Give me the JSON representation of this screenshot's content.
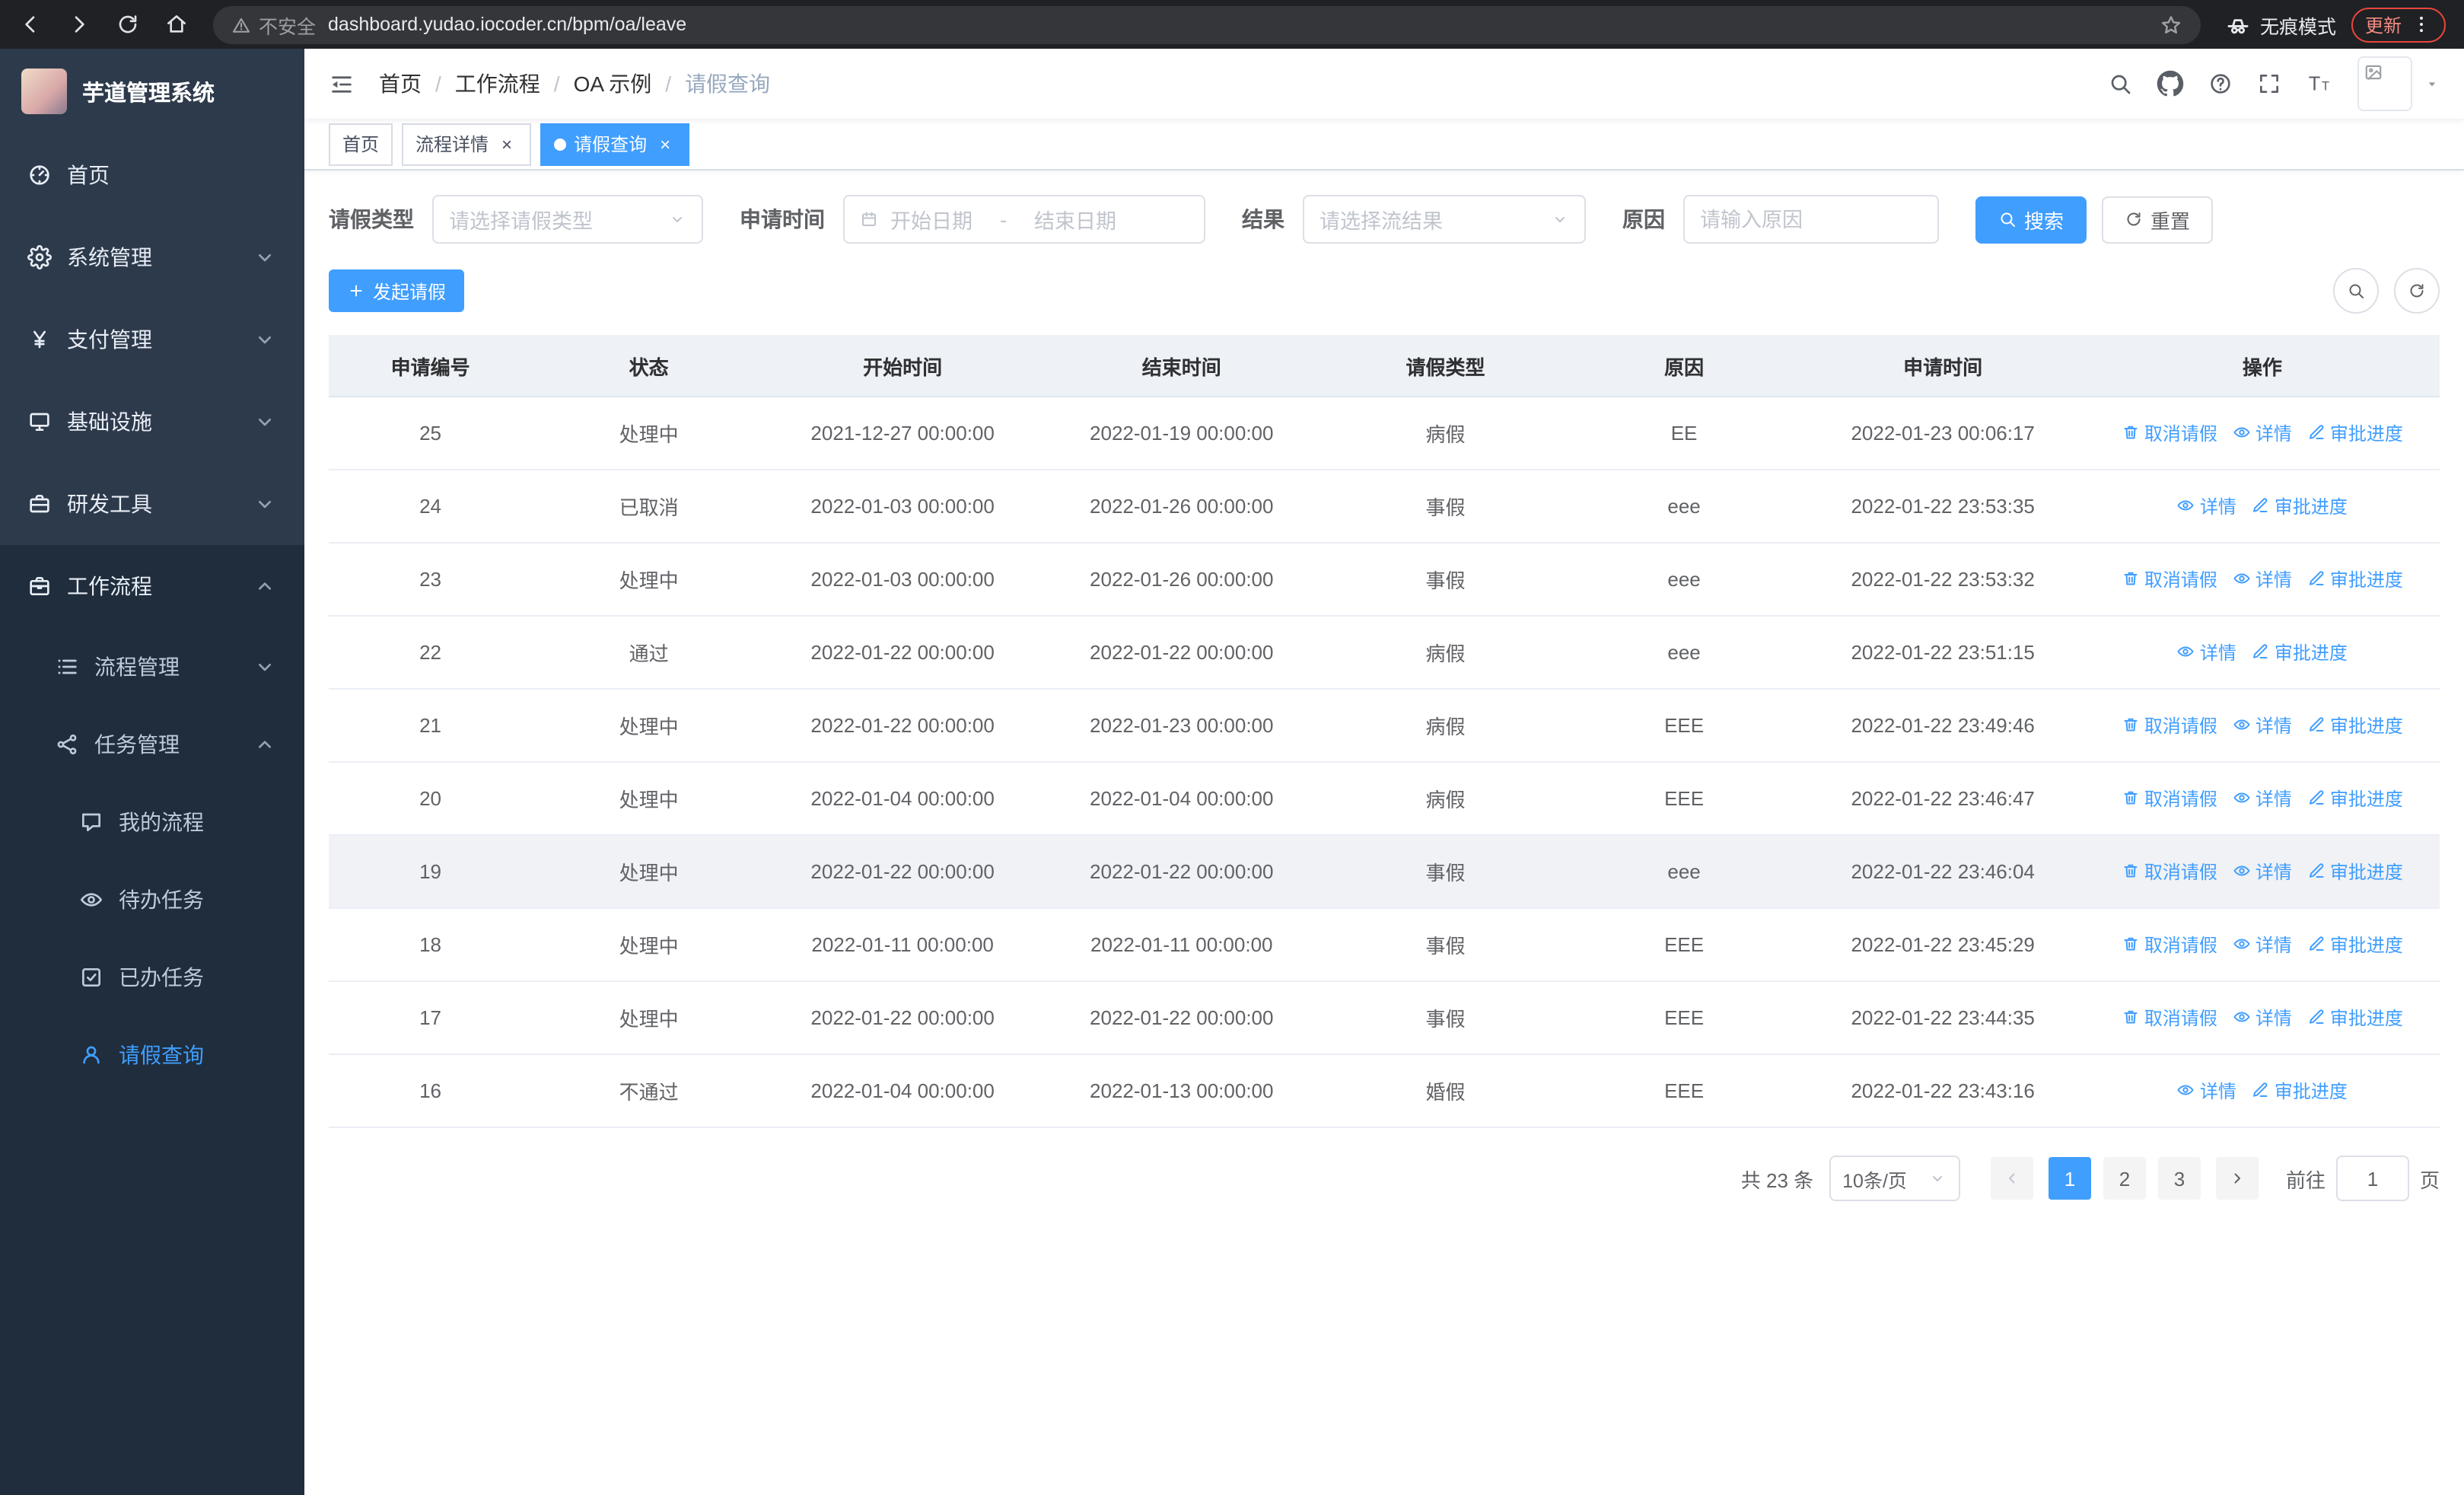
{
  "browser": {
    "security_label": "不安全",
    "url": "dashboard.yudao.iocoder.cn/bpm/oa/leave",
    "incognito_label": "无痕模式",
    "update_label": "更新"
  },
  "sidebar": {
    "title": "芋道管理系统",
    "menu": [
      {
        "name": "home",
        "label": "首页",
        "icon": "dashboard-icon",
        "level": 1
      },
      {
        "name": "system-management",
        "label": "系统管理",
        "icon": "gear-icon",
        "level": 1,
        "arrow": "down"
      },
      {
        "name": "payment-management",
        "label": "支付管理",
        "icon": "yen-icon",
        "level": 1,
        "arrow": "down"
      },
      {
        "name": "infrastructure",
        "label": "基础设施",
        "icon": "infra-icon",
        "level": 1,
        "arrow": "down"
      },
      {
        "name": "dev-tools",
        "label": "研发工具",
        "icon": "toolbox-icon",
        "level": 1,
        "arrow": "down"
      },
      {
        "name": "workflow",
        "label": "工作流程",
        "icon": "briefcase-icon",
        "level": 1,
        "arrow": "up",
        "dark": true
      },
      {
        "name": "process-management",
        "label": "流程管理",
        "icon": "list-icon",
        "level": 2,
        "arrow": "down",
        "dark": true
      },
      {
        "name": "task-management",
        "label": "任务管理",
        "icon": "share-icon",
        "level": 2,
        "arrow": "up",
        "dark": true
      },
      {
        "name": "my-processes",
        "label": "我的流程",
        "icon": "chat-icon",
        "level": 3,
        "dark": true
      },
      {
        "name": "todo-tasks",
        "label": "待办任务",
        "icon": "eye-icon",
        "level": 3,
        "dark": true
      },
      {
        "name": "done-tasks",
        "label": "已办任务",
        "icon": "check-square-icon",
        "level": 3,
        "dark": true
      },
      {
        "name": "leave-query",
        "label": "请假查询",
        "icon": "user-icon",
        "level": 3,
        "dark": true,
        "active": true
      }
    ]
  },
  "header": {
    "breadcrumb": [
      "首页",
      "工作流程",
      "OA 示例",
      "请假查询"
    ],
    "separator": "/"
  },
  "tabs": [
    {
      "name": "home",
      "label": "首页",
      "closable": false,
      "active": false
    },
    {
      "name": "process-detail",
      "label": "流程详情",
      "closable": true,
      "active": false
    },
    {
      "name": "leave-query",
      "label": "请假查询",
      "closable": true,
      "active": true
    }
  ],
  "filters": {
    "leave_type": {
      "label": "请假类型",
      "placeholder": "请选择请假类型"
    },
    "apply_time": {
      "label": "申请时间",
      "start_placeholder": "开始日期",
      "separator": "-",
      "end_placeholder": "结束日期"
    },
    "result": {
      "label": "结果",
      "placeholder": "请选择流结果"
    },
    "reason": {
      "label": "原因",
      "placeholder": "请输入原因"
    },
    "search_label": "搜索",
    "reset_label": "重置"
  },
  "toolbar": {
    "create_label": "发起请假"
  },
  "table": {
    "columns": [
      "申请编号",
      "状态",
      "开始时间",
      "结束时间",
      "请假类型",
      "原因",
      "申请时间",
      "操作"
    ],
    "action_labels": {
      "cancel": "取消请假",
      "detail": "详情",
      "progress": "审批进度"
    },
    "rows": [
      {
        "no": "25",
        "status": "处理中",
        "start": "2021-12-27 00:00:00",
        "end": "2022-01-19 00:00:00",
        "type": "病假",
        "reason": "EE",
        "applied": "2022-01-23 00:06:17",
        "cancellable": true
      },
      {
        "no": "24",
        "status": "已取消",
        "start": "2022-01-03 00:00:00",
        "end": "2022-01-26 00:00:00",
        "type": "事假",
        "reason": "eee",
        "applied": "2022-01-22 23:53:35",
        "cancellable": false
      },
      {
        "no": "23",
        "status": "处理中",
        "start": "2022-01-03 00:00:00",
        "end": "2022-01-26 00:00:00",
        "type": "事假",
        "reason": "eee",
        "applied": "2022-01-22 23:53:32",
        "cancellable": true
      },
      {
        "no": "22",
        "status": "通过",
        "start": "2022-01-22 00:00:00",
        "end": "2022-01-22 00:00:00",
        "type": "病假",
        "reason": "eee",
        "applied": "2022-01-22 23:51:15",
        "cancellable": false
      },
      {
        "no": "21",
        "status": "处理中",
        "start": "2022-01-22 00:00:00",
        "end": "2022-01-23 00:00:00",
        "type": "病假",
        "reason": "EEE",
        "applied": "2022-01-22 23:49:46",
        "cancellable": true
      },
      {
        "no": "20",
        "status": "处理中",
        "start": "2022-01-04 00:00:00",
        "end": "2022-01-04 00:00:00",
        "type": "病假",
        "reason": "EEE",
        "applied": "2022-01-22 23:46:47",
        "cancellable": true
      },
      {
        "no": "19",
        "status": "处理中",
        "start": "2022-01-22 00:00:00",
        "end": "2022-01-22 00:00:00",
        "type": "事假",
        "reason": "eee",
        "applied": "2022-01-22 23:46:04",
        "cancellable": true,
        "hovered": true
      },
      {
        "no": "18",
        "status": "处理中",
        "start": "2022-01-11 00:00:00",
        "end": "2022-01-11 00:00:00",
        "type": "事假",
        "reason": "EEE",
        "applied": "2022-01-22 23:45:29",
        "cancellable": true
      },
      {
        "no": "17",
        "status": "处理中",
        "start": "2022-01-22 00:00:00",
        "end": "2022-01-22 00:00:00",
        "type": "事假",
        "reason": "EEE",
        "applied": "2022-01-22 23:44:35",
        "cancellable": true
      },
      {
        "no": "16",
        "status": "不通过",
        "start": "2022-01-04 00:00:00",
        "end": "2022-01-13 00:00:00",
        "type": "婚假",
        "reason": "EEE",
        "applied": "2022-01-22 23:43:16",
        "cancellable": false
      }
    ]
  },
  "pagination": {
    "total": "共 23 条",
    "page_size": "10条/页",
    "pages": [
      "1",
      "2",
      "3"
    ],
    "active_page": "1",
    "goto_label": "前往",
    "goto_value": "1",
    "unit_label": "页"
  },
  "colors": {
    "primary": "#409EFF",
    "sidebar_bg": "#2d3a4b",
    "submenu_bg": "#1f2d3d",
    "chrome_bg": "#202124",
    "update_accent": "#e8453c"
  }
}
